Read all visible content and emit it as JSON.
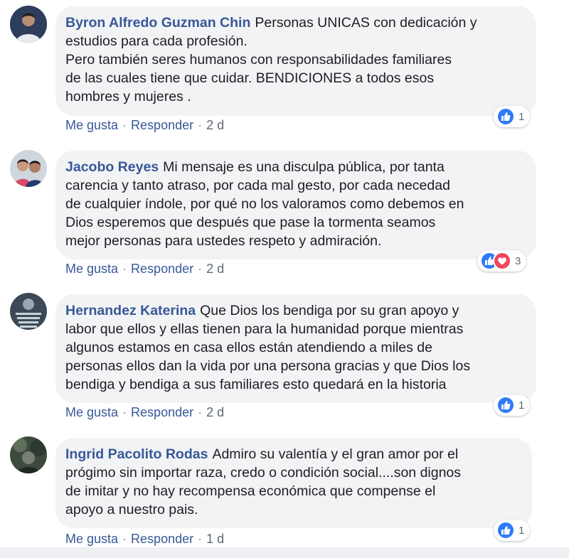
{
  "comments": [
    {
      "author": "Byron Alfredo Guzman Chin",
      "text": "Personas UNICAS con dedicación y\nestudios para cada profesión.\nPero también seres humanos con responsabilidades familiares\nde las cuales tiene que cuidar. BENDICIONES a todos esos\nhombres y mujeres .",
      "like_label": "Me gusta",
      "reply_label": "Responder",
      "time": "2 d",
      "reaction_count": "1",
      "reactions": [
        "like-icon"
      ]
    },
    {
      "author": "Jacobo Reyes",
      "text": "Mi mensaje es una disculpa pública, por tanta\ncarencia y tanto atraso, por cada mal gesto, por cada necedad\nde cualquier índole, por qué no los valoramos como debemos en\nDios esperemos que después que pase la tormenta seamos\nmejor personas para ustedes respeto y admiración.",
      "like_label": "Me gusta",
      "reply_label": "Responder",
      "time": "2 d",
      "reaction_count": "3",
      "reactions": [
        "like-icon",
        "love-icon"
      ]
    },
    {
      "author": "Hernandez Katerina",
      "text": "Que Dios los bendiga por su gran apoyo y\nlabor que ellos y ellas tienen para la humanidad porque mientras\nalgunos estamos en casa ellos están atendiendo a miles de\npersonas ellos dan la vida por una persona gracias y que Dios los\nbendiga y bendiga a sus familiares esto quedará en la historia",
      "like_label": "Me gusta",
      "reply_label": "Responder",
      "time": "2 d",
      "reaction_count": "1",
      "reactions": [
        "like-icon"
      ]
    },
    {
      "author": "Ingrid Pacolito Rodas",
      "text": "Admiro su valentía y el gran amor por el\nprógimo sin importar raza, credo o condición social....son dignos\nde imitar y no hay recompensa económica que compense el\napoyo a nuestro pais.",
      "like_label": "Me gusta",
      "reply_label": "Responder",
      "time": "1 d",
      "reaction_count": "1",
      "reactions": [
        "like-icon"
      ]
    }
  ],
  "colors": {
    "author": "#385898",
    "bubble": "#f2f3f5",
    "like": "#2e7bf6",
    "love": "#f0455f"
  }
}
